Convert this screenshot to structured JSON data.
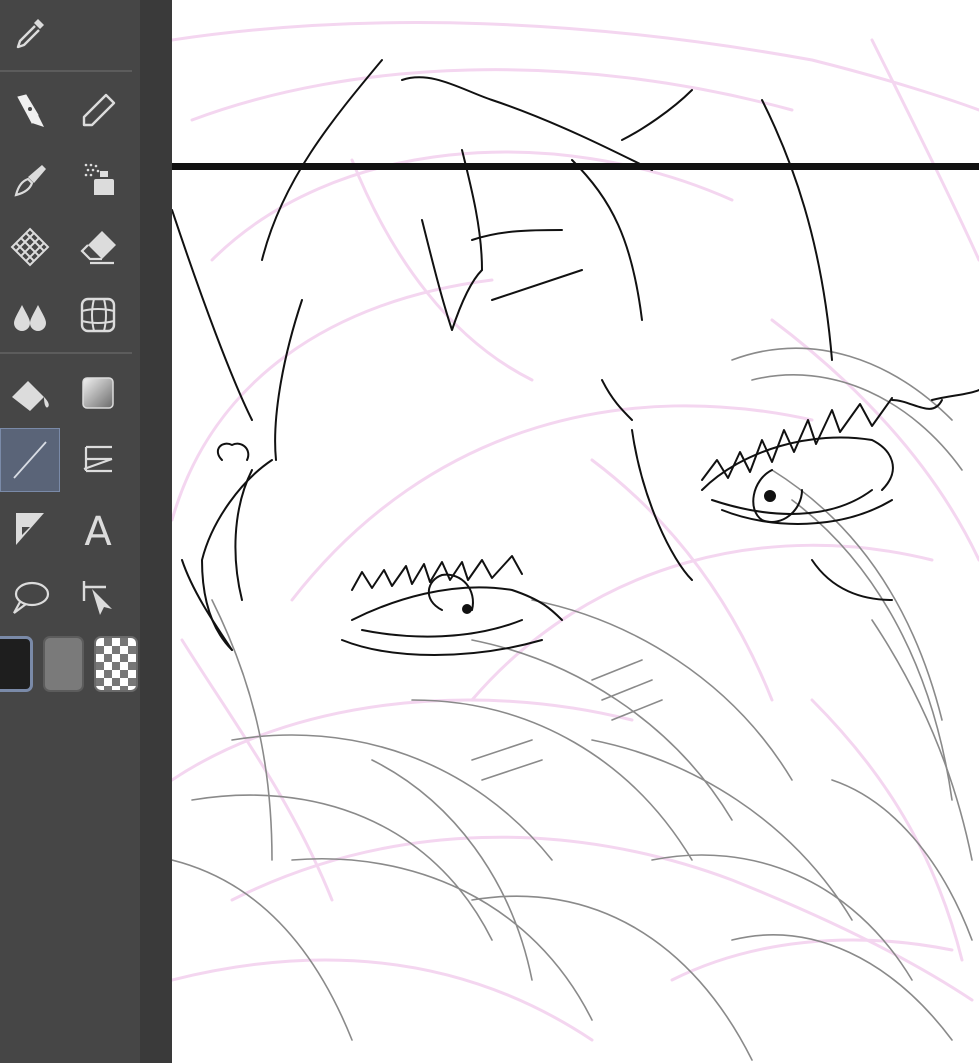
{
  "colors": {
    "toolbar_bg": "#464646",
    "toolbar_edge": "#3a3a3a",
    "selected_tool_bg": "#5a6478",
    "icon": "#dcdcdc",
    "main_color": "#1e1e1e",
    "sub_color": "#7a7a7a",
    "sketch_pink": "#f4d6f0",
    "line_black": "#111111",
    "line_gray": "#8a8a8a"
  },
  "tools": [
    {
      "id": "eyedropper",
      "icon": "eyedropper-icon"
    },
    {
      "id": "pen",
      "icon": "pen-nib-icon",
      "active": true
    },
    {
      "id": "pencil",
      "icon": "pencil-icon"
    },
    {
      "id": "brush",
      "icon": "brush-icon"
    },
    {
      "id": "airbrush",
      "icon": "airbrush-icon"
    },
    {
      "id": "decoration",
      "icon": "decoration-mesh-icon"
    },
    {
      "id": "eraser",
      "icon": "eraser-icon"
    },
    {
      "id": "blend",
      "icon": "blend-drops-icon"
    },
    {
      "id": "ruler",
      "icon": "perspective-ruler-icon"
    },
    {
      "id": "fill",
      "icon": "fill-bucket-icon"
    },
    {
      "id": "gradient",
      "icon": "gradient-icon"
    },
    {
      "id": "figure",
      "icon": "straight-line-icon",
      "selected": true
    },
    {
      "id": "frame-border",
      "icon": "frame-border-icon"
    },
    {
      "id": "correct-line",
      "icon": "correct-line-icon"
    },
    {
      "id": "text",
      "icon": "text-icon",
      "label": "A"
    },
    {
      "id": "balloon",
      "icon": "speech-balloon-icon"
    },
    {
      "id": "operation",
      "icon": "object-select-icon"
    }
  ],
  "color_swatches": [
    {
      "id": "main",
      "color": "#1e1e1e",
      "active": true
    },
    {
      "id": "sub",
      "color": "#7a7a7a"
    },
    {
      "id": "transparent",
      "pattern": "checker"
    }
  ]
}
